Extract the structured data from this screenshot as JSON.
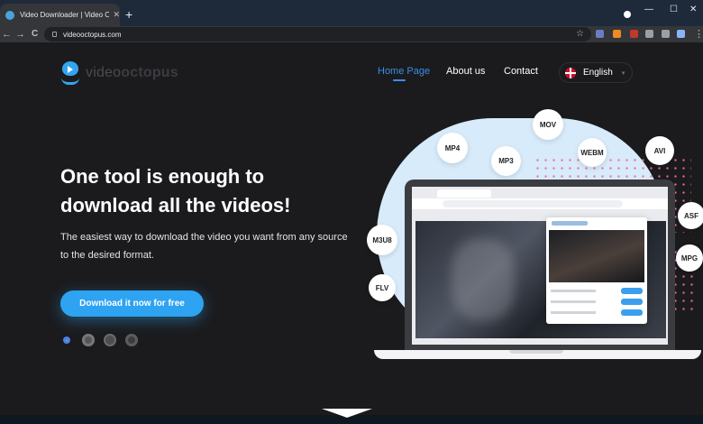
{
  "browser": {
    "tab_title": "Video Downloader | Video Octo",
    "tab_close": "✕",
    "new_tab": "+",
    "back": "←",
    "forward": "→",
    "reload": "C",
    "url": "videooctopus.com",
    "bookmark": "☆",
    "window_minimize": "—",
    "window_maximize": "☐",
    "window_close": "✕",
    "menu": "⋮"
  },
  "site": {
    "logo_text_light": "video",
    "logo_text_bold": "octopus",
    "nav": [
      {
        "label": "Home Page",
        "active": true
      },
      {
        "label": "About us",
        "active": false
      },
      {
        "label": "Contact",
        "active": false
      }
    ],
    "language": "English",
    "lang_chevron": "▾"
  },
  "hero": {
    "headline": "One tool is enough to download all the videos!",
    "subtext": "The easiest way to download the video you want from any source to the desired format.",
    "cta_label": "Download it now for free",
    "browser_icons": [
      "chrome-icon",
      "firefox-icon",
      "safari-icon",
      "edge-icon"
    ]
  },
  "formats": [
    "MOV",
    "MP4",
    "MP3",
    "WEBM",
    "AVI",
    "ASF",
    "M3U8",
    "MPG",
    "FLV"
  ],
  "colors": {
    "accent": "#2ea3f2",
    "nav_active": "#3a8ee8",
    "background": "#1b1b1d",
    "blob": "#d7ebfb",
    "dots": "#f06a9a"
  }
}
